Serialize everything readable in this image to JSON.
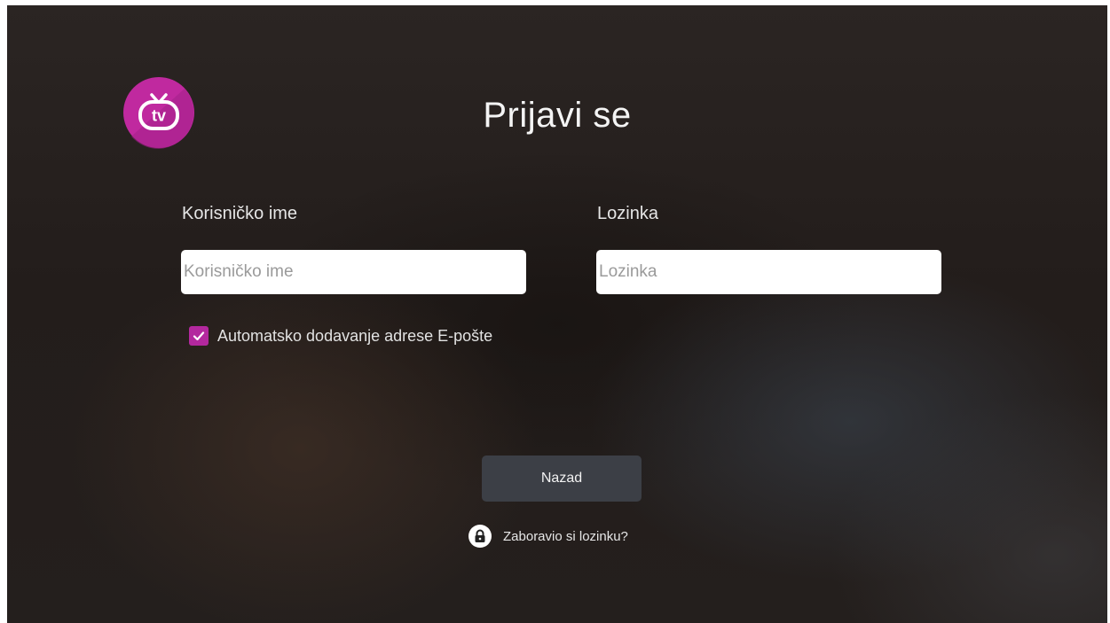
{
  "colors": {
    "accent": "#b3289e",
    "button_bg": "#3c3f46",
    "input_bg": "#ffffff"
  },
  "logo": {
    "text": "tv",
    "icon": "tv-logo-icon"
  },
  "header": {
    "title": "Prijavi se"
  },
  "form": {
    "username": {
      "label": "Korisničko ime",
      "placeholder": "Korisničko ime",
      "value": ""
    },
    "password": {
      "label": "Lozinka",
      "placeholder": "Lozinka",
      "value": ""
    },
    "auto_email": {
      "label": "Automatsko dodavanje adrese E-pošte",
      "checked": true
    }
  },
  "actions": {
    "back_label": "Nazad",
    "forgot_label": "Zaboravio si lozinku?",
    "forgot_icon": "lock-icon"
  }
}
